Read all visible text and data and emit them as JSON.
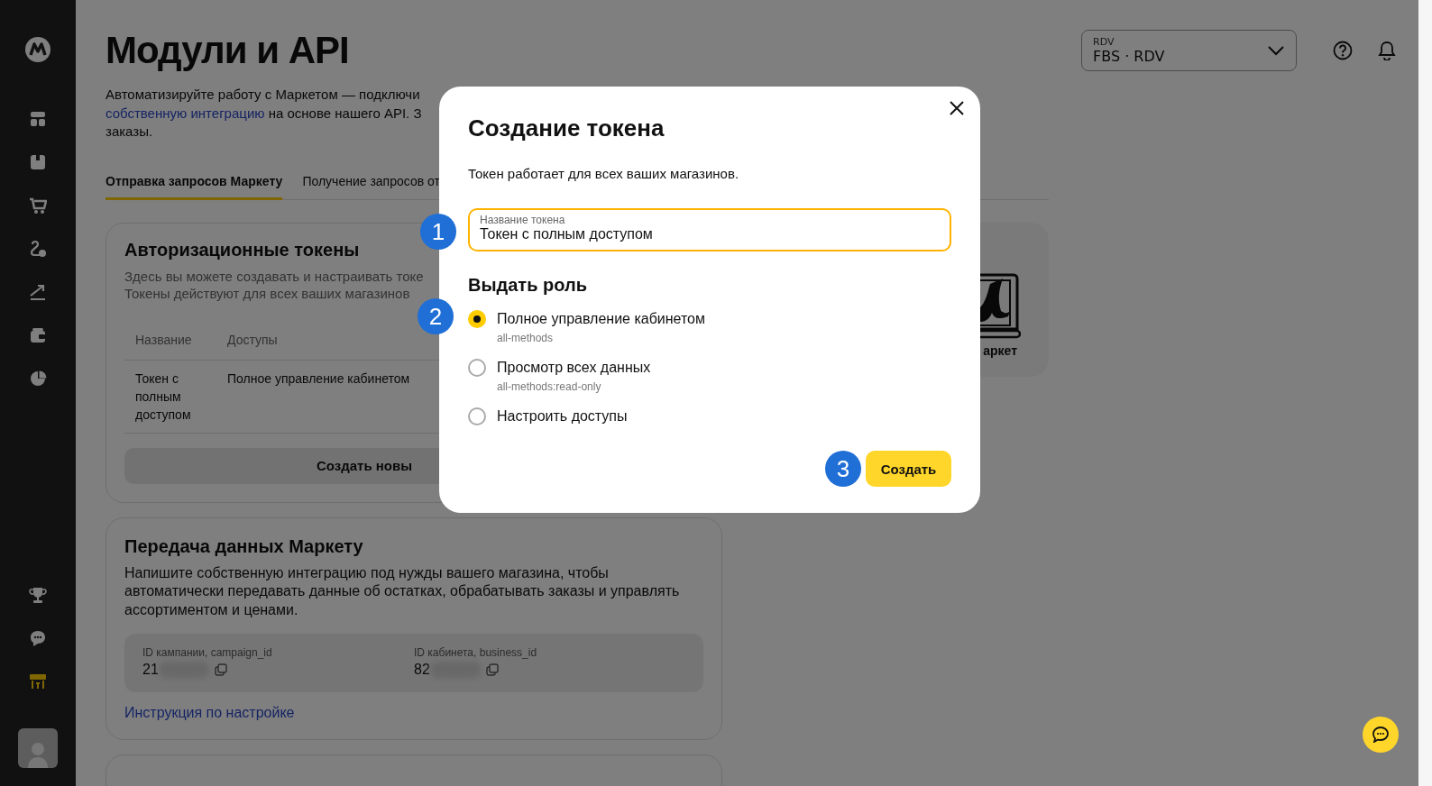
{
  "sidebar": {
    "top_items": [
      {
        "selected": false
      },
      {
        "selected": false
      },
      {
        "selected": false
      },
      {
        "selected": false
      },
      {
        "selected": false
      },
      {
        "selected": false
      },
      {
        "selected": false
      }
    ],
    "bottom_items": [
      {
        "selected": false
      },
      {
        "selected": false
      },
      {
        "selected": true
      }
    ]
  },
  "header": {
    "title": "Модули и API",
    "store_select": {
      "label": "RDV",
      "value": "FBS · RDV"
    }
  },
  "description": {
    "line_1": "Автоматизируйте работу с Маркетом — подключи",
    "link": "собственную интеграцию",
    "line_2_rest": "на основе нашего API. З",
    "line_3": "заказы."
  },
  "tabs": [
    {
      "label": "Отправка запросов Маркету",
      "selected": true
    },
    {
      "label": "Получение запросов от",
      "selected": false
    }
  ],
  "tokens_card": {
    "title": "Авторизационные токены",
    "description_lines": [
      "Здесь вы можете создавать и настраивать токе",
      "Токены действуют для всех ваших магазинов"
    ],
    "table": {
      "columns": [
        "Название",
        "Доступы"
      ],
      "rows": [
        [
          "Токен с полным доступом",
          "Полное управление кабинетом"
        ]
      ]
    },
    "create_button": "Создать новы"
  },
  "market_card": {
    "label": "аркет"
  },
  "integration_card": {
    "title": "Передача данных Маркету",
    "text": "Напишите собственную интеграцию под нужды вашего магазина, чтобы автоматически передавать данные об остатках, обрабатывать заказы и управлять ассортиментом и ценами.",
    "ids": [
      {
        "label": "ID кампании, campaign_id",
        "value": "21"
      },
      {
        "label": "ID кабинета, business_id",
        "value": "82"
      }
    ],
    "link": "Инструкция по настройке"
  },
  "modal": {
    "title": "Создание токена",
    "subtitle": "Токен работает для всех ваших магазинов.",
    "field": {
      "label": "Название токена",
      "value": "Токен с полным доступом"
    },
    "roles_title": "Выдать роль",
    "roles": [
      {
        "label": "Полное управление кабинетом",
        "code": "all-methods",
        "selected": true
      },
      {
        "label": "Просмотр всех данных",
        "code": "all-methods:read-only",
        "selected": false
      },
      {
        "label": "Настроить доступы",
        "selected": false
      }
    ],
    "submit": "Создать"
  },
  "annotations": [
    "1",
    "2",
    "3"
  ]
}
